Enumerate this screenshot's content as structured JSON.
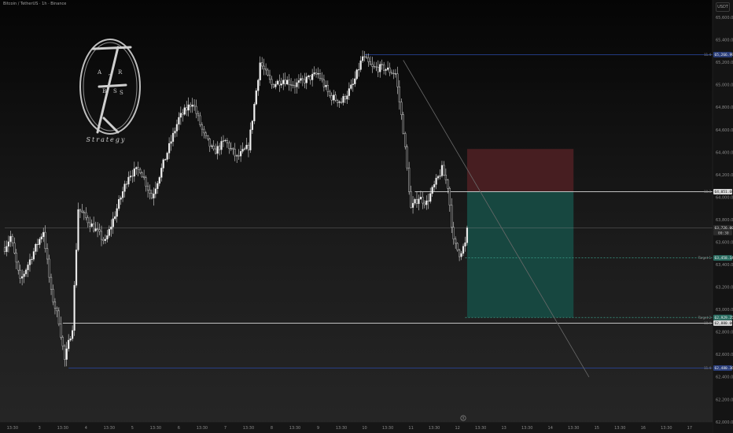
{
  "header": {
    "title": "Bitcoin / TetherUS · 1h · Binance",
    "currency": "USDT"
  },
  "logo": {
    "letters": [
      "A",
      "R",
      "B",
      "S",
      "T",
      "S"
    ],
    "tagline": "Strategy"
  },
  "chart_data": {
    "type": "candlestick",
    "symbol": "Bitcoin / TetherUS",
    "interval": "1h",
    "exchange": "Binance",
    "price_axis": {
      "range": [
        62000,
        65700
      ],
      "ticks": [
        {
          "v": 65600,
          "label": "65,600.00"
        },
        {
          "v": 65400,
          "label": "65,400.00"
        },
        {
          "v": 65200,
          "label": "65,200.00"
        },
        {
          "v": 65000,
          "label": "65,000.00"
        },
        {
          "v": 64800,
          "label": "64,800.00"
        },
        {
          "v": 64600,
          "label": "64,600.00"
        },
        {
          "v": 64400,
          "label": "64,400.00"
        },
        {
          "v": 64200,
          "label": "64,200.00"
        },
        {
          "v": 64000,
          "label": "64,000.00"
        },
        {
          "v": 63800,
          "label": "63,800.00"
        },
        {
          "v": 63600,
          "label": "63,600.00"
        },
        {
          "v": 63400,
          "label": "63,400.00"
        },
        {
          "v": 63200,
          "label": "63,200.00"
        },
        {
          "v": 63000,
          "label": "63,000.00"
        },
        {
          "v": 62800,
          "label": "62,800.00"
        },
        {
          "v": 62600,
          "label": "62,600.00"
        },
        {
          "v": 62400,
          "label": "62,400.00"
        },
        {
          "v": 62200,
          "label": "62,200.00"
        },
        {
          "v": 62000,
          "label": "62,000.00"
        }
      ]
    },
    "time_axis": {
      "range": [
        0,
        240
      ],
      "labels": [
        {
          "t": 4,
          "label": "13:30"
        },
        {
          "t": 18,
          "label": "3"
        },
        {
          "t": 30,
          "label": "13:30"
        },
        {
          "t": 42,
          "label": "4"
        },
        {
          "t": 54,
          "label": "13:30"
        },
        {
          "t": 66,
          "label": "5"
        },
        {
          "t": 78,
          "label": "13:30"
        },
        {
          "t": 90,
          "label": "6"
        },
        {
          "t": 102,
          "label": "13:30"
        },
        {
          "t": 114,
          "label": "7"
        },
        {
          "t": 126,
          "label": "13:30"
        },
        {
          "t": 138,
          "label": "8"
        },
        {
          "t": 150,
          "label": "13:30"
        },
        {
          "t": 162,
          "label": "9"
        },
        {
          "t": 174,
          "label": "13:30"
        },
        {
          "t": 186,
          "label": "10"
        },
        {
          "t": 198,
          "label": "13:30"
        },
        {
          "t": 210,
          "label": "11"
        },
        {
          "t": 222,
          "label": "13:30"
        },
        {
          "t": 234,
          "label": "12"
        },
        {
          "t": 246,
          "label": "13:30"
        },
        {
          "t": 258,
          "label": "13"
        },
        {
          "t": 270,
          "label": "13:30"
        },
        {
          "t": 282,
          "label": "14"
        },
        {
          "t": 294,
          "label": "13:30"
        },
        {
          "t": 306,
          "label": "15"
        },
        {
          "t": 318,
          "label": "13:30"
        },
        {
          "t": 330,
          "label": "16"
        },
        {
          "t": 342,
          "label": "13:30"
        },
        {
          "t": 354,
          "label": "17"
        }
      ],
      "day_marker": "9"
    },
    "anchors": [
      {
        "t": 0,
        "p": 63550
      },
      {
        "t": 3,
        "p": 63650
      },
      {
        "t": 8,
        "p": 63250
      },
      {
        "t": 14,
        "p": 63480
      },
      {
        "t": 20,
        "p": 63700
      },
      {
        "t": 24,
        "p": 63150
      },
      {
        "t": 28,
        "p": 62900
      },
      {
        "t": 31,
        "p": 62550
      },
      {
        "t": 35,
        "p": 62850
      },
      {
        "t": 38,
        "p": 63900
      },
      {
        "t": 45,
        "p": 63750
      },
      {
        "t": 52,
        "p": 63600
      },
      {
        "t": 58,
        "p": 63900
      },
      {
        "t": 64,
        "p": 64200
      },
      {
        "t": 70,
        "p": 64250
      },
      {
        "t": 76,
        "p": 64000
      },
      {
        "t": 82,
        "p": 64300
      },
      {
        "t": 90,
        "p": 64700
      },
      {
        "t": 97,
        "p": 64850
      },
      {
        "t": 103,
        "p": 64550
      },
      {
        "t": 108,
        "p": 64400
      },
      {
        "t": 114,
        "p": 64500
      },
      {
        "t": 120,
        "p": 64350
      },
      {
        "t": 126,
        "p": 64450
      },
      {
        "t": 132,
        "p": 65200
      },
      {
        "t": 138,
        "p": 65000
      },
      {
        "t": 144,
        "p": 65050
      },
      {
        "t": 150,
        "p": 65000
      },
      {
        "t": 156,
        "p": 65050
      },
      {
        "t": 162,
        "p": 65100
      },
      {
        "t": 168,
        "p": 64900
      },
      {
        "t": 174,
        "p": 64850
      },
      {
        "t": 180,
        "p": 65000
      },
      {
        "t": 185,
        "p": 65250
      },
      {
        "t": 190,
        "p": 65150
      },
      {
        "t": 196,
        "p": 65150
      },
      {
        "t": 202,
        "p": 65100
      },
      {
        "t": 206,
        "p": 64600
      },
      {
        "t": 210,
        "p": 63900
      },
      {
        "t": 214,
        "p": 64000
      },
      {
        "t": 218,
        "p": 63950
      },
      {
        "t": 222,
        "p": 64100
      },
      {
        "t": 226,
        "p": 64250
      },
      {
        "t": 229,
        "p": 64100
      },
      {
        "t": 232,
        "p": 63600
      },
      {
        "t": 235,
        "p": 63500
      },
      {
        "t": 238,
        "p": 63580
      },
      {
        "t": 239,
        "p": 63700
      }
    ],
    "levels": [
      {
        "name": "upper-blue",
        "price": 65270,
        "t_start": 186,
        "label": "11.4",
        "badge": "65,266.99",
        "color": "#2b4aa8"
      },
      {
        "name": "entry",
        "price": 64050,
        "t_start": 212,
        "label": "10.3",
        "badge": "64,051.60",
        "color": "#d8d8d8"
      },
      {
        "name": "current",
        "price": 63728,
        "t_start": 0,
        "label": "",
        "badge": "63,726.00",
        "badge2": "00:30",
        "color": "#8a8a8a"
      },
      {
        "name": "target-1",
        "price": 63460,
        "t_start": 238,
        "label": "Target 1",
        "badge": "63,458.14",
        "color": "#3aa08a",
        "dashed": true
      },
      {
        "name": "target-2",
        "price": 62930,
        "t_start": 238,
        "label": "Target 2",
        "badge": "62,929.25",
        "color": "#3aa08a",
        "dashed": true
      },
      {
        "name": "lower-white",
        "price": 62880,
        "t_start": 30,
        "label": "10.4",
        "badge": "62,880.00",
        "color": "#d8d8d8"
      },
      {
        "name": "lower-blue",
        "price": 62480,
        "t_start": 33,
        "label": "11.4",
        "badge": "62,480.36",
        "color": "#2b4aa8"
      }
    ],
    "position": {
      "entry": 64050,
      "stop": 64430,
      "target": 62930,
      "t_start": 239,
      "t_end": 294
    },
    "trendline": {
      "t1": 206,
      "p1": 65220,
      "t2": 302,
      "p2": 62400
    }
  }
}
